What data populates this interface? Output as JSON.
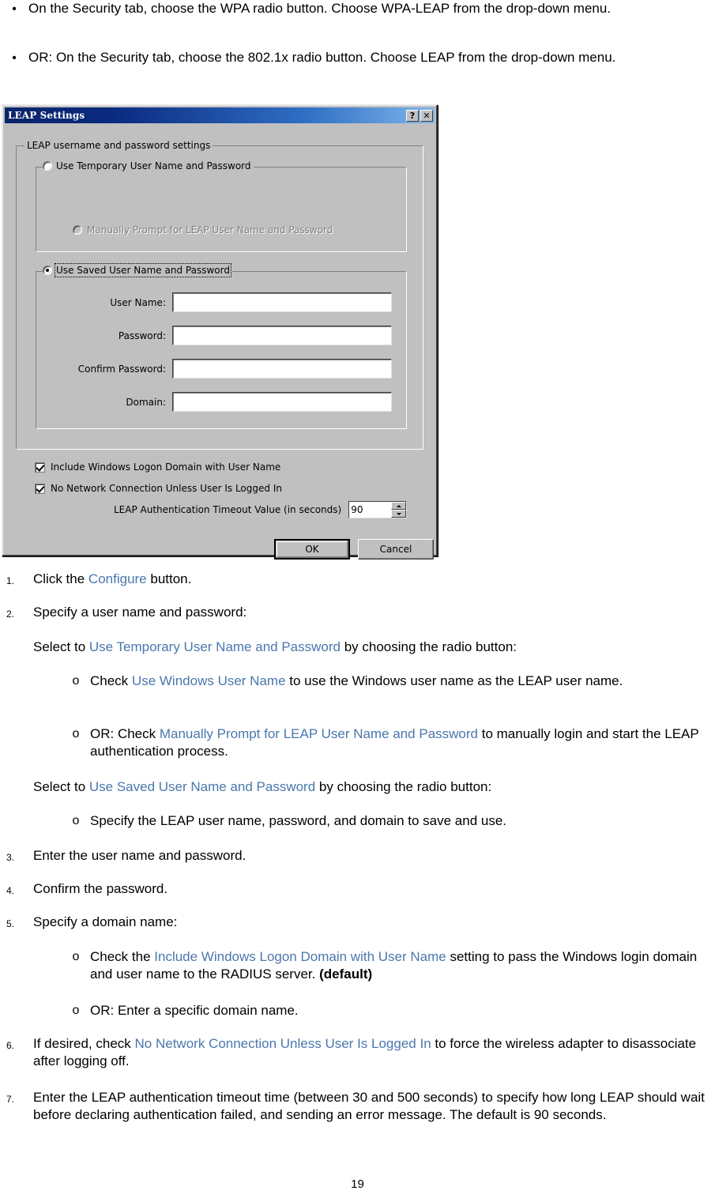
{
  "document": {
    "bullets": [
      {
        "marker": "•",
        "text": "On the Security tab, choose the WPA radio button. Choose WPA-LEAP from the drop-down menu."
      },
      {
        "marker": "•",
        "text": "OR: On the Security tab, choose the 802.1x radio button. Choose LEAP from the drop-down menu."
      }
    ],
    "steps": [
      {
        "marker": "1.",
        "pre": "Click the ",
        "ref": "Configure",
        "post": " button."
      },
      {
        "marker": "2.",
        "pre": "Specify a user name and password:",
        "ref": "",
        "post": ""
      },
      {
        "marker": "3.",
        "pre": "Enter the user name and password.",
        "ref": "",
        "post": ""
      },
      {
        "marker": "4.",
        "pre": "Confirm the password.",
        "ref": "",
        "post": ""
      },
      {
        "marker": "5.",
        "pre": "Specify a domain name:",
        "ref": "",
        "post": ""
      },
      {
        "marker": "6.",
        "pre": "If desired, check ",
        "ref": "No Network Connection Unless User Is Logged In",
        "post": " to force the wireless adapter to disassociate after logging off."
      },
      {
        "marker": "7.",
        "pre": "Enter the LEAP authentication timeout time (between 30 and 500 seconds) to specify how long LEAP should wait before declaring authentication failed, and sending an error message.  The default is 90 seconds.",
        "ref": "",
        "post": ""
      }
    ],
    "para_temp": {
      "pre": "Select to ",
      "ref": "Use Temporary User Name and Password",
      "post": " by choosing the radio button:"
    },
    "para_saved": {
      "pre": "Select to ",
      "ref": "Use Saved User Name and Password",
      "post": " by choosing the radio button:"
    },
    "sub_items": [
      {
        "marker": "o",
        "pre": "Check ",
        "ref": "Use Windows User Name",
        "post": " to use the Windows user name as the LEAP user name.",
        "bold": ""
      },
      {
        "marker": "o",
        "pre": "OR: Check ",
        "ref": "Manually Prompt for LEAP User Name and Password",
        "post": " to manually login and start the LEAP authentication process.",
        "bold": ""
      },
      {
        "marker": "o",
        "pre": "Specify the LEAP user name, password, and domain to save and use.",
        "ref": "",
        "post": "",
        "bold": ""
      },
      {
        "marker": "o",
        "pre": "Check the ",
        "ref": "Include Windows Logon Domain with User Name",
        "post": " setting to pass the Windows login domain and user name to the RADIUS server. ",
        "bold": "(default)"
      },
      {
        "marker": "o",
        "pre": "OR: Enter a specific domain name.",
        "ref": "",
        "post": "",
        "bold": ""
      }
    ],
    "page_number": "19",
    "link_color": "#4a77ac"
  },
  "dialog": {
    "title": "LEAP Settings",
    "titlebar_buttons": [
      {
        "name": "help-button",
        "glyph": "?"
      },
      {
        "name": "close-button",
        "glyph": "✕"
      }
    ],
    "outer_group_label": "LEAP username and password settings",
    "temp_group": {
      "radio_label": "Use Temporary User Name and Password",
      "radio_checked": false,
      "inner_radio_label": "Manually Prompt for LEAP User Name and Password",
      "inner_radio_checked": false,
      "inner_radio_disabled": true
    },
    "saved_group": {
      "radio_label": "Use Saved User Name and Password",
      "radio_checked": true,
      "fields": [
        {
          "label": "User Name:",
          "value": "",
          "name": "user-name-field"
        },
        {
          "label": "Password:",
          "value": "",
          "name": "password-field"
        },
        {
          "label": "Confirm Password:",
          "value": "",
          "name": "confirm-password-field"
        },
        {
          "label": "Domain:",
          "value": "",
          "name": "domain-field"
        }
      ]
    },
    "checkboxes": [
      {
        "label": "Include Windows Logon Domain with User Name",
        "checked": true,
        "name": "include-windows-logon-domain-checkbox"
      },
      {
        "label": "No Network Connection Unless User Is Logged In",
        "checked": true,
        "name": "no-network-connection-checkbox"
      }
    ],
    "timeout": {
      "label": "LEAP Authentication Timeout Value (in seconds)",
      "value": "90"
    },
    "buttons": [
      {
        "label": "OK",
        "name": "ok-button",
        "default": true
      },
      {
        "label": "Cancel",
        "name": "cancel-button",
        "default": false
      }
    ]
  }
}
